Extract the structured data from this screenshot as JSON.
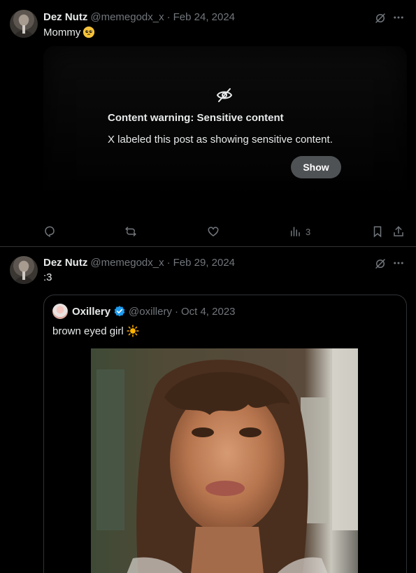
{
  "posts": [
    {
      "author": {
        "name": "Dez Nutz",
        "handle": "@memegodx_x"
      },
      "separator": "·",
      "date": "Feb 24, 2024",
      "text": "Mommy",
      "text_emoji": "pleading-face-icon",
      "sensitive": {
        "title": "Content warning: Sensitive content",
        "body": "X labeled this post as showing sensitive content.",
        "button": "Show"
      },
      "actions": {
        "reply": "",
        "repost": "",
        "like": "",
        "views": "3"
      }
    },
    {
      "author": {
        "name": "Dez Nutz",
        "handle": "@memegodx_x"
      },
      "separator": "·",
      "date": "Feb 29, 2024",
      "text": ":3",
      "quote": {
        "author": {
          "name": "Oxillery",
          "handle": "@oxillery"
        },
        "separator": "·",
        "date": "Oct 4, 2023",
        "text": "brown eyed girl",
        "text_emoji": "sun-icon"
      }
    }
  ],
  "colors": {
    "background": "#000000",
    "text": "#e7e9ea",
    "muted": "#71767b",
    "border": "#2f3336",
    "verified": "#1d9bf0",
    "show_button": "#4f5255"
  }
}
